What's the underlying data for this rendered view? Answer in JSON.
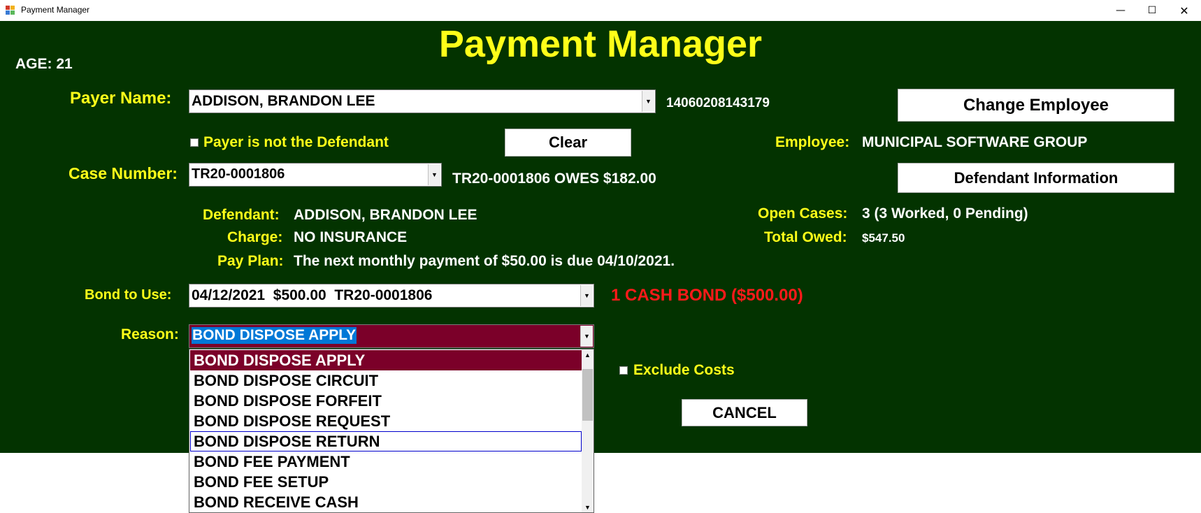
{
  "window": {
    "title": "Payment Manager",
    "controls": [
      "minimize-icon",
      "maximize-icon",
      "close-icon"
    ]
  },
  "colors": {
    "background": "#033300",
    "label": "#ffff19",
    "value": "#ffffff",
    "alert": "#ff1a1a",
    "selection": "#7b0029",
    "highlight": "#0078d7"
  },
  "header": {
    "title": "Payment Manager",
    "age": "AGE: 21"
  },
  "payer": {
    "label": "Payer Name:",
    "value": "ADDISON, BRANDON LEE",
    "id": "14060208143179",
    "not_defendant_label": "Payer is not the Defendant",
    "clear_label": "Clear"
  },
  "employee": {
    "change_label": "Change Employee",
    "label": "Employee:",
    "value": "MUNICIPAL SOFTWARE GROUP",
    "defendant_info_label": "Defendant Information"
  },
  "case": {
    "label": "Case Number:",
    "value": "TR20-0001806",
    "owes": "TR20-0001806 OWES $182.00"
  },
  "details": {
    "defendant_label": "Defendant:",
    "defendant": "ADDISON, BRANDON LEE",
    "charge_label": "Charge:",
    "charge": "NO INSURANCE",
    "payplan_label": "Pay Plan:",
    "payplan": "The next monthly payment of $50.00 is due 04/10/2021.",
    "open_cases_label": "Open Cases:",
    "open_cases": "3 (3 Worked, 0 Pending)",
    "total_owed_label": "Total Owed:",
    "total_owed": "$547.50"
  },
  "bond": {
    "label": "Bond to Use:",
    "value": "04/12/2021  $500.00  TR20-0001806",
    "summary": "1 CASH BOND ($500.00)"
  },
  "reason": {
    "label": "Reason:",
    "value": "BOND DISPOSE APPLY",
    "options": [
      "BOND DISPOSE APPLY",
      "BOND DISPOSE CIRCUIT",
      "BOND DISPOSE FORFEIT",
      "BOND DISPOSE REQUEST",
      "BOND DISPOSE RETURN",
      "BOND FEE PAYMENT",
      "BOND FEE SETUP",
      "BOND RECEIVE CASH"
    ]
  },
  "options": {
    "exclude_costs_label": "Exclude Costs",
    "cancel_label": "CANCEL"
  }
}
